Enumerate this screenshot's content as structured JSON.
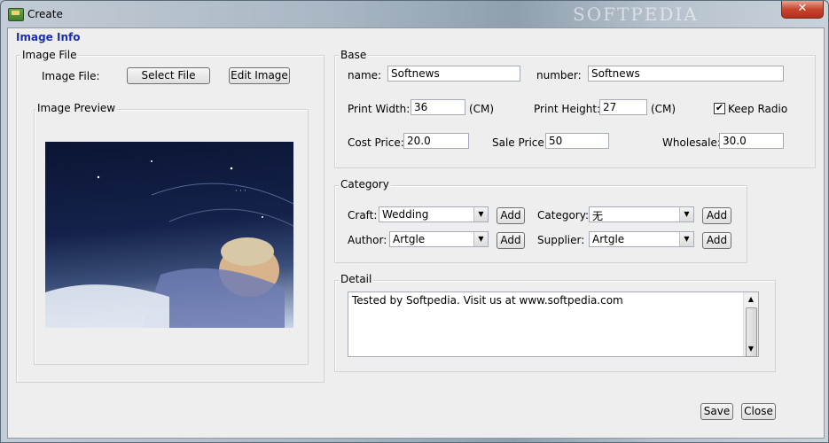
{
  "window": {
    "title": "Create",
    "watermark": "SOFTPEDIA",
    "close_label": "✕"
  },
  "image_info": {
    "section_title": "Image Info",
    "image_file_group": "Image File",
    "image_file_label": "Image File:",
    "select_file_label": "Select File",
    "edit_image_label": "Edit Image",
    "preview_group": "Image Preview"
  },
  "base": {
    "group": "Base",
    "name_label": "name:",
    "name_value": "Softnews",
    "number_label": "number:",
    "number_value": "Softnews",
    "print_width_label": "Print Width:",
    "print_width_value": "36",
    "print_width_unit": "(CM)",
    "print_height_label": "Print Height:",
    "print_height_value": "27",
    "print_height_unit": "(CM)",
    "keep_radio_label": "Keep Radio",
    "keep_radio_checked": true,
    "cost_price_label": "Cost Price:",
    "cost_price_value": "20.0",
    "sale_price_label": "Sale Price:",
    "sale_price_value": "50",
    "wholesale_label": "Wholesale:",
    "wholesale_value": "30.0"
  },
  "category": {
    "group": "Category",
    "craft_label": "Craft:",
    "craft_value": "Wedding",
    "category_label": "Category:",
    "category_value": "无",
    "author_label": "Author:",
    "author_value": "Artgle",
    "supplier_label": "Supplier:",
    "supplier_value": "Artgle",
    "add_label": "Add"
  },
  "detail": {
    "group": "Detail",
    "text": "Tested by Softpedia. Visit us at www.softpedia.com"
  },
  "footer": {
    "save_label": "Save",
    "close_label": "Close"
  },
  "icons": {
    "dropdown": "▼",
    "check": "✔",
    "scroll_up": "▲",
    "scroll_down": "▼"
  }
}
